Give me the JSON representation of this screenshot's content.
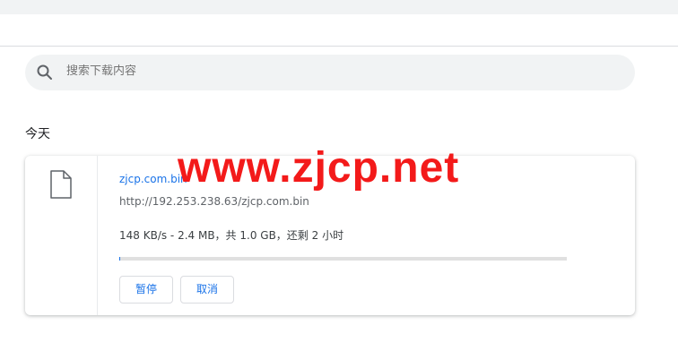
{
  "search": {
    "placeholder": "搜索下载内容",
    "icon": "search-icon"
  },
  "section": {
    "heading": "今天"
  },
  "download": {
    "file_icon": "file-icon",
    "file_name": "zjcp.com.bin",
    "url": "http://192.253.238.63/zjcp.com.bin",
    "status": "148 KB/s - 2.4 MB，共 1.0 GB，还剩 2 小时",
    "progress_fraction": 0.0024,
    "pause_label": "暂停",
    "cancel_label": "取消"
  },
  "watermark": {
    "text": "www.zjcp.net"
  },
  "colors": {
    "accent": "#1a73e8",
    "watermark": "#f31a1a",
    "search_bg": "#f1f3f4"
  }
}
